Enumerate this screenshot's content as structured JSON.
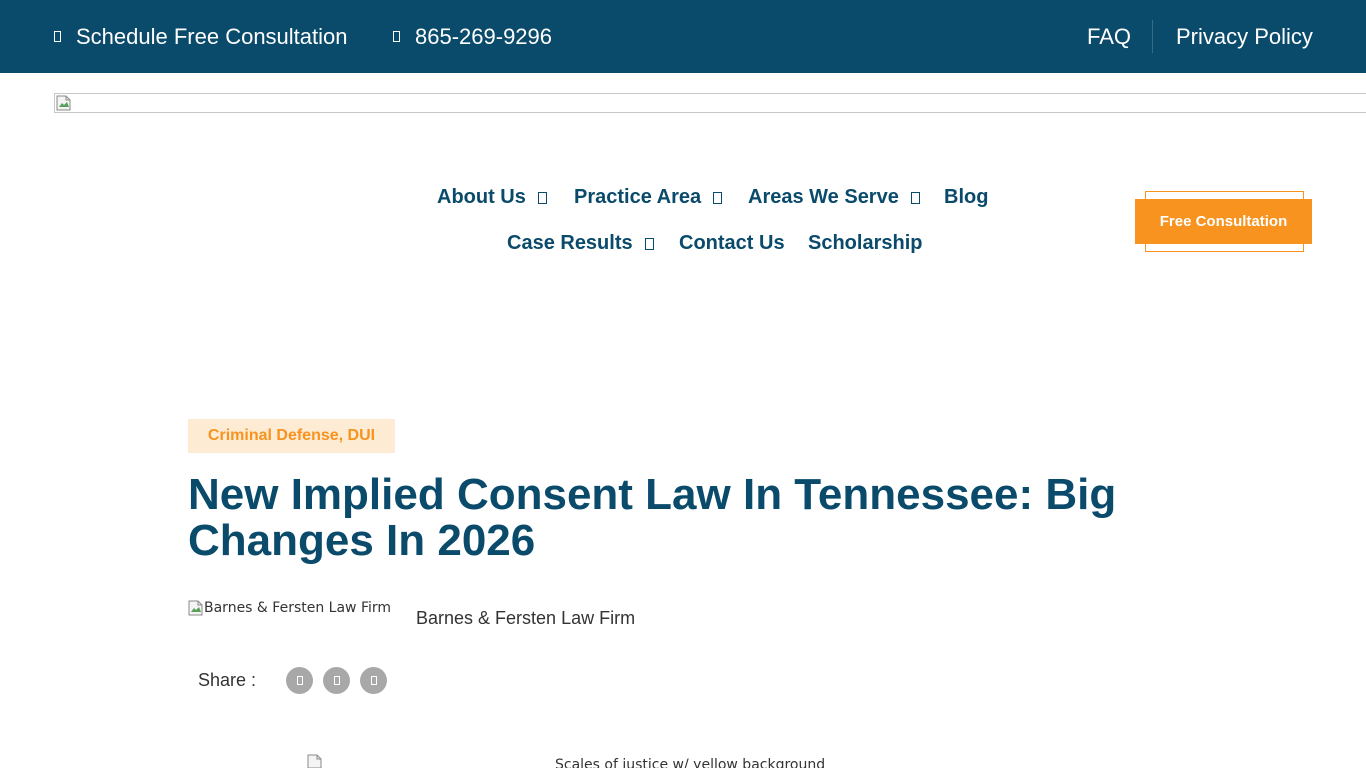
{
  "colors": {
    "topbar_bg": "#0a4a6b",
    "nav_text": "#0a4a6b",
    "accent": "#f7931e",
    "badge_bg": "#fdebd3",
    "share_btn": "#a8a8a8"
  },
  "topbar": {
    "schedule_label": "Schedule Free Consultation",
    "schedule_icon": "calendar-icon",
    "phone_label": "865-269-9296",
    "phone_icon": "phone-icon",
    "faq_label": "FAQ",
    "privacy_label": "Privacy Policy"
  },
  "logo": {
    "icon": "broken-image-icon"
  },
  "nav": {
    "items": [
      {
        "label": "About Us",
        "has_dropdown": true
      },
      {
        "label": "Practice Area",
        "has_dropdown": true
      },
      {
        "label": "Areas We Serve",
        "has_dropdown": true
      },
      {
        "label": "Blog",
        "has_dropdown": false
      },
      {
        "label": "Case Results",
        "has_dropdown": true
      },
      {
        "label": "Contact Us",
        "has_dropdown": false
      },
      {
        "label": "Scholarship",
        "has_dropdown": false
      }
    ],
    "cta_label": "Free Consultation"
  },
  "article": {
    "category": "Criminal Defense, DUI",
    "title": "New Implied Consent Law In Tennessee: Big Changes In 2026",
    "author_image_alt": "Barnes & Fersten Law Firm",
    "author_name": "Barnes & Fersten Law Firm",
    "share_label": "Share :",
    "share_buttons": [
      "facebook-icon",
      "twitter-icon",
      "linkedin-icon"
    ],
    "featured_image_alt": "Scales of justice w/ yellow background"
  }
}
